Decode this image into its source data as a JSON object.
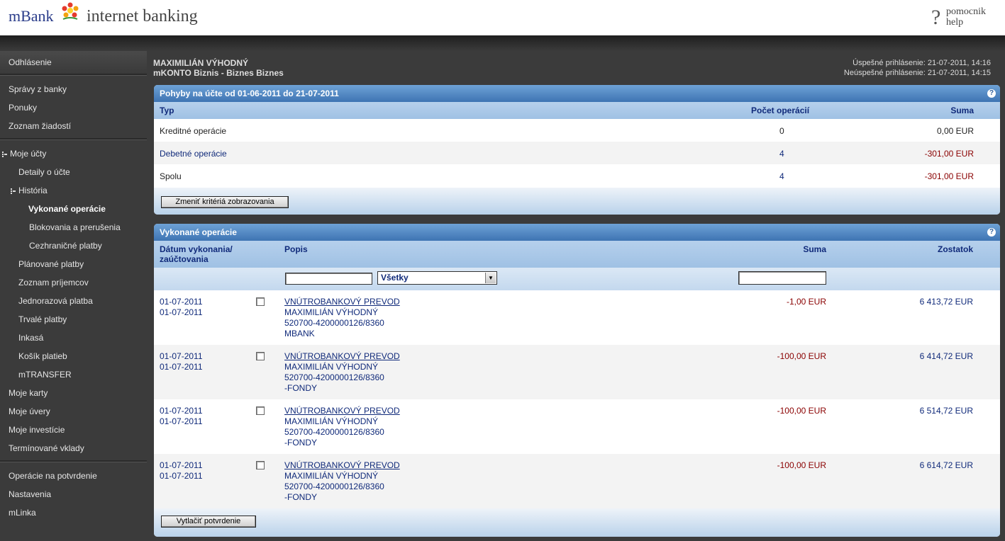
{
  "header": {
    "logo_text": "mBank",
    "product_text": "internet banking",
    "help_symbol": "?",
    "help_line1": "pomocnik",
    "help_line2": "help"
  },
  "sidebar": {
    "logout": "Odhlásenie",
    "items": [
      "Správy z banky",
      "Ponuky",
      "Zoznam žiadostí",
      "Moje účty",
      "Detaily o účte",
      "História",
      "Vykonané operácie",
      "Blokovania a prerušenia",
      "Cezhraničné platby",
      "Plánované platby",
      "Zoznam príjemcov",
      "Jednorazová platba",
      "Trvalé platby",
      "Inkasá",
      "Košík platieb",
      "mTRANSFER",
      "Moje karty",
      "Moje úvery",
      "Moje investície",
      "Termínované vklady",
      "Operácie na potvrdenie",
      "Nastavenia",
      "mLinka"
    ]
  },
  "main": {
    "user_name": "MAXIMILIÁN VÝHODNÝ",
    "account_name": "mKONTO Biznis - Biznes Biznes",
    "login_ok": "Úspešné prihlásenie: 21-07-2011, 14:16",
    "login_fail": "Neúspešné prihlásenie: 21-07-2011, 14:15"
  },
  "summary": {
    "title": "Pohyby na účte od 01-06-2011 do 21-07-2011",
    "help": "?",
    "col_type": "Typ",
    "col_count": "Počet operácií",
    "col_sum": "Suma",
    "rows": [
      {
        "type": "Kreditné operácie",
        "count": "0",
        "sum": "0,00 EUR"
      },
      {
        "type": "Debetné operácie",
        "count": "4",
        "sum": "-301,00 EUR"
      },
      {
        "type": "Spolu",
        "count": "4",
        "sum": "-301,00 EUR"
      }
    ],
    "button": "Zmeniť kritériá zobrazovania"
  },
  "operations": {
    "title": "Vykonané operácie",
    "help": "?",
    "col_date_1": "Dátum vykonania/",
    "col_date_2": "zaúčtovania",
    "col_desc": "Popis",
    "col_sum": "Suma",
    "col_balance": "Zostatok",
    "filter_select": "Všetky",
    "filter_arrow": "▼",
    "rows": [
      {
        "date1": "01-07-2011",
        "date2": "01-07-2011",
        "title": "VNÚTROBANKOVÝ PREVOD",
        "line2": "MAXIMILIÁN VÝHODNÝ",
        "line3": "520700-4200000126/8360",
        "line4": "MBANK",
        "sum": "-1,00 EUR",
        "balance": "6 413,72 EUR"
      },
      {
        "date1": "01-07-2011",
        "date2": "01-07-2011",
        "title": "VNÚTROBANKOVÝ PREVOD",
        "line2": "MAXIMILIÁN VÝHODNÝ",
        "line3": "520700-4200000126/8360",
        "line4": "-FONDY",
        "sum": "-100,00 EUR",
        "balance": "6 414,72 EUR"
      },
      {
        "date1": "01-07-2011",
        "date2": "01-07-2011",
        "title": "VNÚTROBANKOVÝ PREVOD",
        "line2": "MAXIMILIÁN VÝHODNÝ",
        "line3": "520700-4200000126/8360",
        "line4": "-FONDY",
        "sum": "-100,00 EUR",
        "balance": "6 514,72 EUR"
      },
      {
        "date1": "01-07-2011",
        "date2": "01-07-2011",
        "title": "VNÚTROBANKOVÝ PREVOD",
        "line2": "MAXIMILIÁN VÝHODNÝ",
        "line3": "520700-4200000126/8360",
        "line4": "-FONDY",
        "sum": "-100,00 EUR",
        "balance": "6 614,72 EUR"
      }
    ],
    "button": "Vytlačiť potvrdenie"
  },
  "colors": {
    "accent_blue": "#3e74b3",
    "text_blue": "#102a7a",
    "negative_red": "#8a0000",
    "sidebar_bg": "#3b3b3b"
  }
}
